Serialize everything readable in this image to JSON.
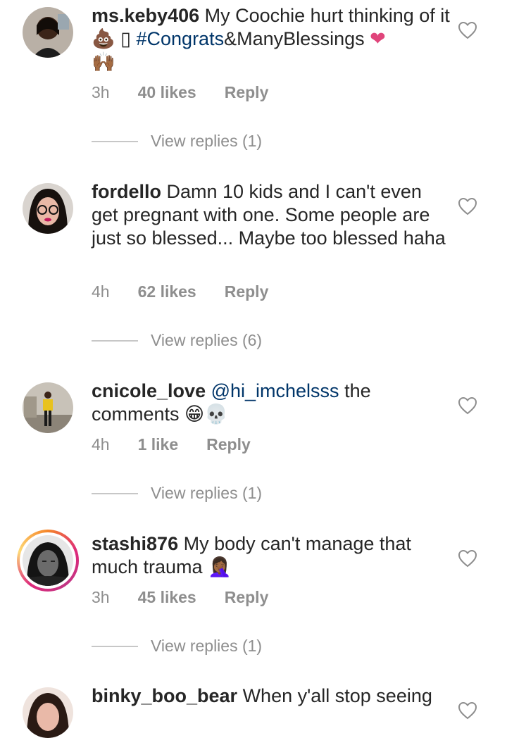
{
  "comments": [
    {
      "username": "ms.keby406",
      "text_before": " My Coochie hurt thinking of it ",
      "emoji_1": "💩",
      "glyph": "▯",
      "hashtag": " #Congrats",
      "text_after": "&ManyBlessings ",
      "emoji_2": "❤",
      "emoji_3": "🙌🏾",
      "time": "3h",
      "likes": "40 likes",
      "reply_label": "Reply",
      "view_replies": "View replies (1)"
    },
    {
      "username": "fordello",
      "text": " Damn 10 kids and I can't even get pregnant with one. Some people are just so blessed... Maybe too blessed haha",
      "time": "4h",
      "likes": "62 likes",
      "reply_label": "Reply",
      "view_replies": "View replies (6)"
    },
    {
      "username": "cnicole_love",
      "mention": " @hi_imchelsss",
      "text": " the comments ",
      "emoji_1": "😁",
      "emoji_2": "💀",
      "time": "4h",
      "likes": "1 like",
      "reply_label": "Reply",
      "view_replies": "View replies (1)"
    },
    {
      "username": "stashi876",
      "text": " My body can't manage that much trauma ",
      "emoji_1": "🤦🏾‍♀️",
      "time": "3h",
      "likes": "45 likes",
      "reply_label": "Reply",
      "view_replies": "View replies (1)"
    },
    {
      "username": "binky_boo_bear",
      "text": " When y'all stop seeing"
    }
  ],
  "colors": {
    "text": "#262626",
    "meta": "#8e8e8e",
    "hashtag": "#003569",
    "heart_emoji": "#e0457b"
  }
}
